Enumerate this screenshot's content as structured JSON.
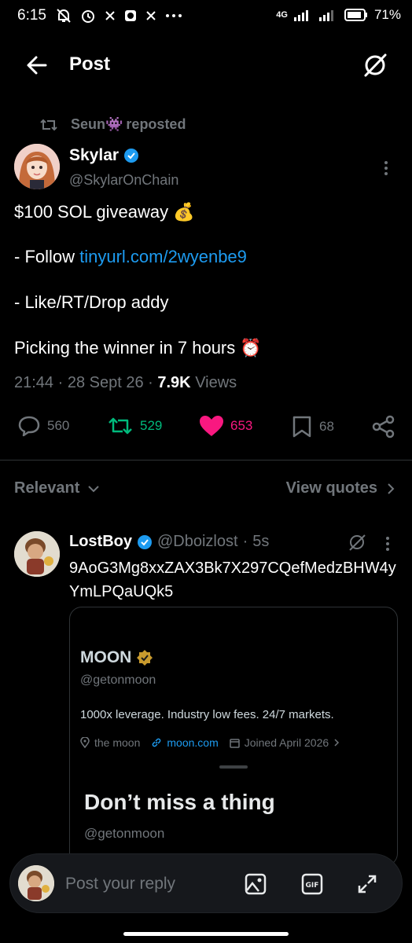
{
  "status_bar": {
    "time": "6:15",
    "network": "4G",
    "battery": "71%"
  },
  "header": {
    "title": "Post"
  },
  "repost": {
    "user": "Seun👾",
    "label": "reposted"
  },
  "post": {
    "author_name": "Skylar",
    "author_handle": "@SkylarOnChain",
    "line1": "$100 SOL giveaway 💰",
    "line2_prefix": "- Follow ",
    "line2_link": "tinyurl.com/2wyenbe9",
    "line3": "- Like/RT/Drop addy",
    "line4": "Picking the winner in 7 hours ⏰",
    "time": "21:44",
    "date": "28 Sept 26",
    "views_count": "7.9K",
    "views_label": "Views",
    "replies": "560",
    "reposts": "529",
    "likes": "653",
    "bookmarks": "68"
  },
  "sort": {
    "relevant": "Relevant",
    "view_quotes": "View quotes"
  },
  "reply": {
    "name": "LostBoy",
    "handle": "@Dboizlost",
    "time": "5s",
    "text": "9AoG3Mg8xxZAX3Bk7X297CQefMedzBHW4yYmLPQaUQk5",
    "card": {
      "name": "MOON",
      "handle": "@getonmoon",
      "bio": "1000x leverage. Industry low fees. 24/7 markets.",
      "location": "the moon",
      "website": "moon.com",
      "joined": "Joined April 2026",
      "headline": "Don’t miss a thing",
      "headline_handle": "@getonmoon"
    }
  },
  "composer": {
    "placeholder": "Post your reply"
  },
  "colors": {
    "accent": "#1d9bf0",
    "repost_green": "#00ba7c",
    "like_pink": "#f91880",
    "muted": "#71767b",
    "gold_badge": "#c99b2e"
  }
}
